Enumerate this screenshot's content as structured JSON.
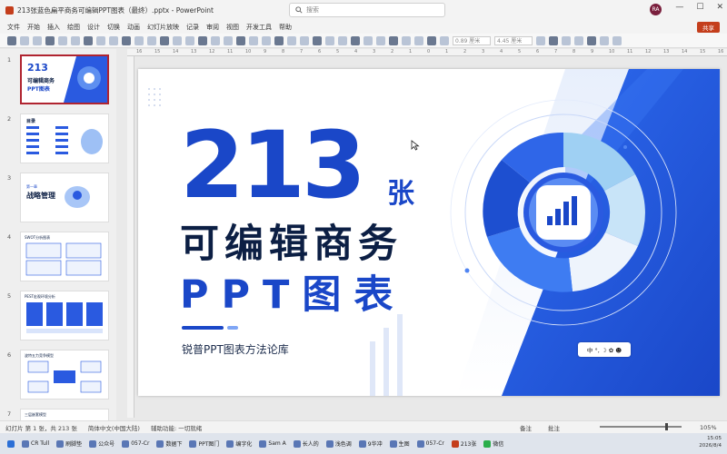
{
  "window": {
    "title": "213张蓝色扁平商务可编辑PPT图表（最终）.pptx  -  PowerPoint",
    "search_placeholder": "搜索",
    "avatar_initials": "RA",
    "share_label": "共享",
    "controls": [
      "—",
      "☐",
      "✕"
    ]
  },
  "menu": [
    "文件",
    "开始",
    "插入",
    "绘图",
    "设计",
    "切换",
    "动画",
    "幻灯片放映",
    "记录",
    "审阅",
    "视图",
    "开发工具",
    "帮助"
  ],
  "toolbar": {
    "width_field": "0.89 厘米",
    "height_field": "4.45 厘米"
  },
  "ruler": {
    "ticks": [
      "16",
      "15",
      "14",
      "13",
      "12",
      "11",
      "10",
      "9",
      "8",
      "7",
      "6",
      "5",
      "4",
      "3",
      "2",
      "1",
      "0",
      "1",
      "2",
      "3",
      "4",
      "5",
      "6",
      "7",
      "8",
      "9",
      "10",
      "11",
      "12",
      "13",
      "14",
      "15",
      "16"
    ]
  },
  "thumbnails": [
    {
      "num": "1",
      "line1": "213",
      "line2": "可编辑商务",
      "line3": "PPT图表"
    },
    {
      "num": "2",
      "line1": "目录"
    },
    {
      "num": "3",
      "line1": "第一章",
      "line2": "战略管理"
    },
    {
      "num": "4",
      "line1": "SWOT分析图表"
    },
    {
      "num": "5",
      "line1": "PEST宏观环境分析"
    },
    {
      "num": "6",
      "line1": "波特五力竞争模型"
    },
    {
      "num": "7",
      "line1": "三层嵌套模型"
    }
  ],
  "slide": {
    "big_number": "213",
    "zhang": "张",
    "line2": "可编辑商务",
    "line3": "PPT图表",
    "subtitle": "锐普PPT图表方法论库",
    "floating_toolbar": "中 °, ☽ ✿ ☻"
  },
  "status": {
    "slide_info": "幻灯片 第 1 张，共 213 张",
    "language": "简体中文(中国大陆)",
    "accessibility": "辅助功能: 一切就绪",
    "notes": "备注",
    "comments": "批注",
    "zoom": "105%"
  },
  "taskbar": {
    "items": [
      "CR Tull",
      "刷脚垫",
      "公众号",
      "057-Cr",
      "数据下",
      "PPT图门",
      "编字化",
      "Sam A",
      "长人的",
      "浅色调",
      "9华冲",
      "生图",
      "057-Cr",
      "213张",
      "微信"
    ],
    "time": "15:05",
    "date": "2026/8/4"
  },
  "colors": {
    "brand_blue": "#1a47c8",
    "deep_navy": "#0c1f44",
    "accent_red": "#c43e1c",
    "selection_red": "#b02430"
  }
}
